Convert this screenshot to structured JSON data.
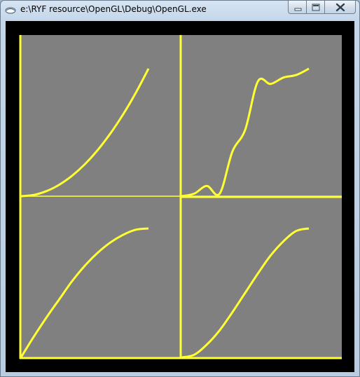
{
  "window": {
    "title": "e:\\RYF resource\\OpenGL\\Debug\\OpenGL.exe",
    "icon": "window-app-icon"
  },
  "caption_buttons": [
    {
      "name": "minimize-button",
      "icon": "minimize-icon"
    },
    {
      "name": "maximize-button",
      "icon": "maximize-icon"
    },
    {
      "name": "close-button",
      "icon": "close-icon"
    }
  ],
  "colors": {
    "canvas_background": "#000000",
    "viewport_fill": "#808080",
    "curve_color": "#ffff33"
  },
  "chart_data": [
    {
      "type": "line",
      "panel": "top-left",
      "curve": "ease-in (quadratic)",
      "x": [
        0,
        0.1,
        0.2,
        0.3,
        0.4,
        0.5,
        0.6,
        0.7,
        0.8,
        0.9,
        1.0
      ],
      "y": [
        0,
        0.01,
        0.04,
        0.09,
        0.16,
        0.25,
        0.36,
        0.49,
        0.64,
        0.81,
        1.0
      ]
    },
    {
      "type": "line",
      "panel": "top-right",
      "curve": "ease-in-out elastic/bounce",
      "x": [
        0,
        0.1,
        0.2,
        0.3,
        0.4,
        0.5,
        0.6,
        0.7,
        0.8,
        0.9,
        1.0
      ],
      "y": [
        0,
        0.02,
        0.08,
        0.02,
        0.35,
        0.52,
        0.9,
        0.88,
        0.93,
        0.95,
        1.0
      ]
    },
    {
      "type": "line",
      "panel": "bottom-left",
      "curve": "ease-out (sine)",
      "x": [
        0,
        0.1,
        0.2,
        0.3,
        0.4,
        0.5,
        0.6,
        0.7,
        0.8,
        0.9,
        1.0
      ],
      "y": [
        0,
        0.16,
        0.31,
        0.45,
        0.59,
        0.71,
        0.81,
        0.89,
        0.95,
        0.99,
        1.0
      ]
    },
    {
      "type": "line",
      "panel": "bottom-right",
      "curve": "ease-in-out (sine)",
      "x": [
        0,
        0.1,
        0.2,
        0.3,
        0.4,
        0.5,
        0.6,
        0.7,
        0.8,
        0.9,
        1.0
      ],
      "y": [
        0,
        0.02,
        0.1,
        0.21,
        0.35,
        0.5,
        0.65,
        0.79,
        0.9,
        0.98,
        1.0
      ]
    }
  ]
}
